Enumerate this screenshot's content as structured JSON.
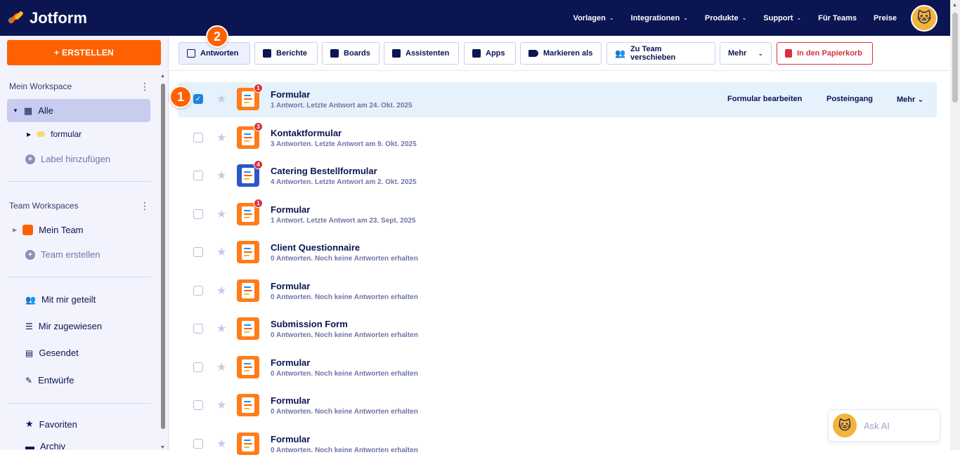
{
  "app": {
    "name": "Jotform"
  },
  "nav": [
    "Vorlagen",
    "Integrationen",
    "Produkte",
    "Support",
    "Für Teams",
    "Preise"
  ],
  "nav_has_chevron": [
    true,
    true,
    true,
    true,
    false,
    false
  ],
  "sidebar": {
    "create_label": "+ ERSTELLEN",
    "workspace_title": "Mein Workspace",
    "all_label": "Alle",
    "label_item": "formular",
    "add_label": "Label hinzufügen",
    "team_title": "Team Workspaces",
    "team_item": "Mein Team",
    "create_team": "Team erstellen",
    "shared": "Mit mir geteilt",
    "assigned": "Mir zugewiesen",
    "sent": "Gesendet",
    "drafts": "Entwürfe",
    "favorites": "Favoriten",
    "archive": "Archiv"
  },
  "toolbar": {
    "responses": "Antworten",
    "reports": "Berichte",
    "boards": "Boards",
    "assistants": "Assistenten",
    "apps": "Apps",
    "mark_as": "Markieren als",
    "move_team": "Zu Team verschieben",
    "more": "Mehr",
    "trash": "In den Papierkorb"
  },
  "markers": {
    "one": "1",
    "two": "2"
  },
  "row_actions": {
    "edit": "Formular bearbeiten",
    "inbox": "Posteingang",
    "more": "Mehr"
  },
  "forms": [
    {
      "name": "Formular",
      "meta": "1 Antwort. Letzte Antwort am 24. Okt. 2025",
      "badge": "1",
      "selected": true,
      "icon": "payment"
    },
    {
      "name": "Kontaktformular",
      "meta": "3 Antworten. Letzte Antwort am 9. Okt. 2025",
      "badge": "3",
      "selected": false,
      "icon": "form"
    },
    {
      "name": "Catering Bestellformular",
      "meta": "4 Antworten. Letzte Antwort am 2. Okt. 2025",
      "badge": "4",
      "selected": false,
      "icon": "catering"
    },
    {
      "name": "Formular",
      "meta": "1 Antwort. Letzte Antwort am 23. Sept. 2025",
      "badge": "1",
      "selected": false,
      "icon": "payment"
    },
    {
      "name": "Client Questionnaire",
      "meta": "0 Antworten. Noch keine Antworten erhalten",
      "badge": "",
      "selected": false,
      "icon": "form"
    },
    {
      "name": "Formular",
      "meta": "0 Antworten. Noch keine Antworten erhalten",
      "badge": "",
      "selected": false,
      "icon": "payment"
    },
    {
      "name": "Submission Form",
      "meta": "0 Antworten. Noch keine Antworten erhalten",
      "badge": "",
      "selected": false,
      "icon": "form"
    },
    {
      "name": "Formular",
      "meta": "0 Antworten. Noch keine Antworten erhalten",
      "badge": "",
      "selected": false,
      "icon": "form"
    },
    {
      "name": "Formular",
      "meta": "0 Antworten. Noch keine Antworten erhalten",
      "badge": "",
      "selected": false,
      "icon": "form"
    },
    {
      "name": "Formular",
      "meta": "0 Antworten. Noch keine Antworten erhalten",
      "badge": "",
      "selected": false,
      "icon": "form"
    }
  ],
  "ask_ai": "Ask AI",
  "colors": {
    "topbar": "#0a1551",
    "accent": "#ff6100",
    "danger": "#d9303e",
    "selected_row": "#e5f1fb"
  }
}
